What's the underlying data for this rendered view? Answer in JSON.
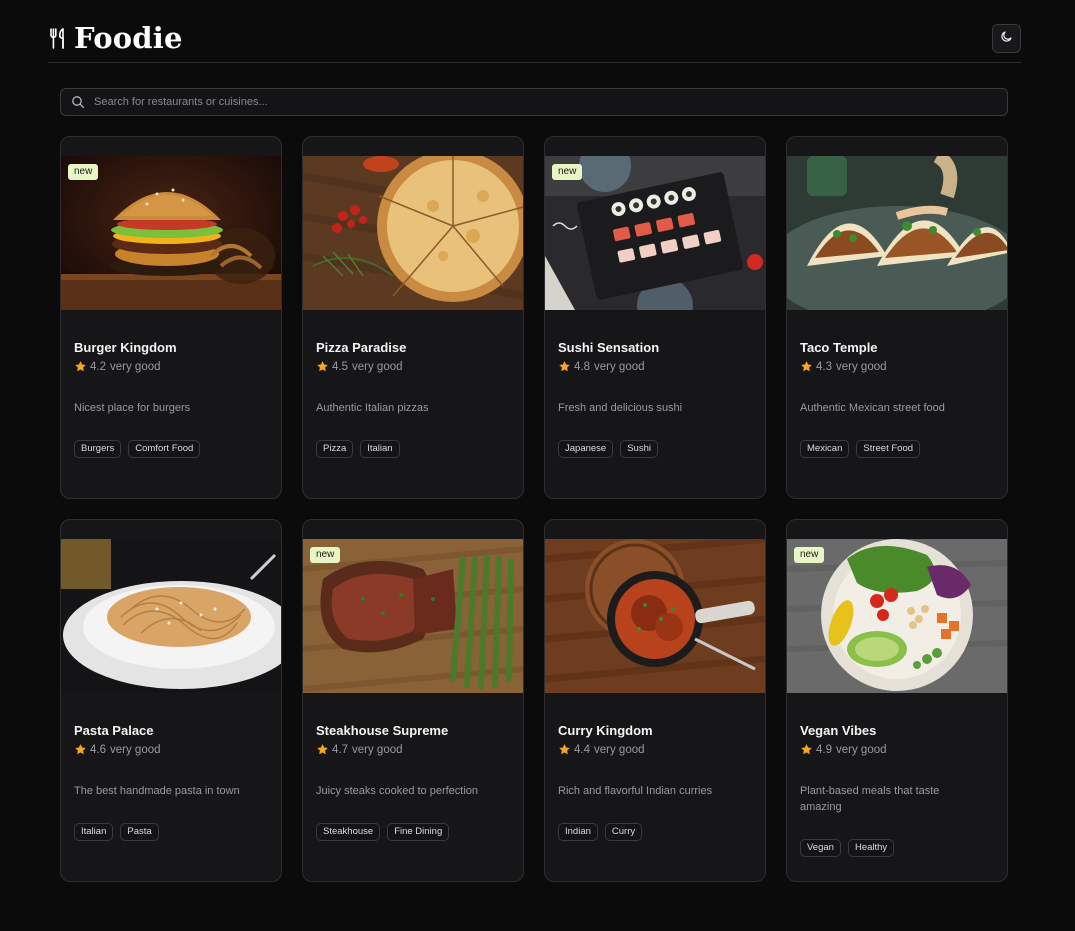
{
  "app": {
    "title": "Foodie",
    "logo_icon": "utensils-icon",
    "theme_toggle_icon": "moon-icon"
  },
  "search": {
    "placeholder": "Search for restaurants or cuisines...",
    "value": "",
    "icon": "search-icon"
  },
  "colors": {
    "background": "#0b0b0c",
    "card": "#161618",
    "badge": "#e8f5c4",
    "star": "#f5a623"
  },
  "restaurants": [
    {
      "name": "Burger Kingdom",
      "rating": "4.2",
      "rating_label": "very good",
      "description": "Nicest place for burgers",
      "tags": [
        "Burgers",
        "Comfort Food"
      ],
      "is_new": true,
      "badge": "new",
      "image": "burger"
    },
    {
      "name": "Pizza Paradise",
      "rating": "4.5",
      "rating_label": "very good",
      "description": "Authentic Italian pizzas",
      "tags": [
        "Pizza",
        "Italian"
      ],
      "is_new": false,
      "badge": "",
      "image": "pizza"
    },
    {
      "name": "Sushi Sensation",
      "rating": "4.8",
      "rating_label": "very good",
      "description": "Fresh and delicious sushi",
      "tags": [
        "Japanese",
        "Sushi"
      ],
      "is_new": true,
      "badge": "new",
      "image": "sushi"
    },
    {
      "name": "Taco Temple",
      "rating": "4.3",
      "rating_label": "very good",
      "description": "Authentic Mexican street food",
      "tags": [
        "Mexican",
        "Street Food"
      ],
      "is_new": false,
      "badge": "",
      "image": "tacos"
    },
    {
      "name": "Pasta Palace",
      "rating": "4.6",
      "rating_label": "very good",
      "description": "The best handmade pasta in town",
      "tags": [
        "Italian",
        "Pasta"
      ],
      "is_new": false,
      "badge": "",
      "image": "pasta"
    },
    {
      "name": "Steakhouse Supreme",
      "rating": "4.7",
      "rating_label": "very good",
      "description": "Juicy steaks cooked to perfection",
      "tags": [
        "Steakhouse",
        "Fine Dining"
      ],
      "is_new": true,
      "badge": "new",
      "image": "steak"
    },
    {
      "name": "Curry Kingdom",
      "rating": "4.4",
      "rating_label": "very good",
      "description": "Rich and flavorful Indian curries",
      "tags": [
        "Indian",
        "Curry"
      ],
      "is_new": false,
      "badge": "",
      "image": "curry"
    },
    {
      "name": "Vegan Vibes",
      "rating": "4.9",
      "rating_label": "very good",
      "description": "Plant-based meals that taste amazing",
      "tags": [
        "Vegan",
        "Healthy"
      ],
      "is_new": true,
      "badge": "new",
      "image": "salad"
    }
  ]
}
